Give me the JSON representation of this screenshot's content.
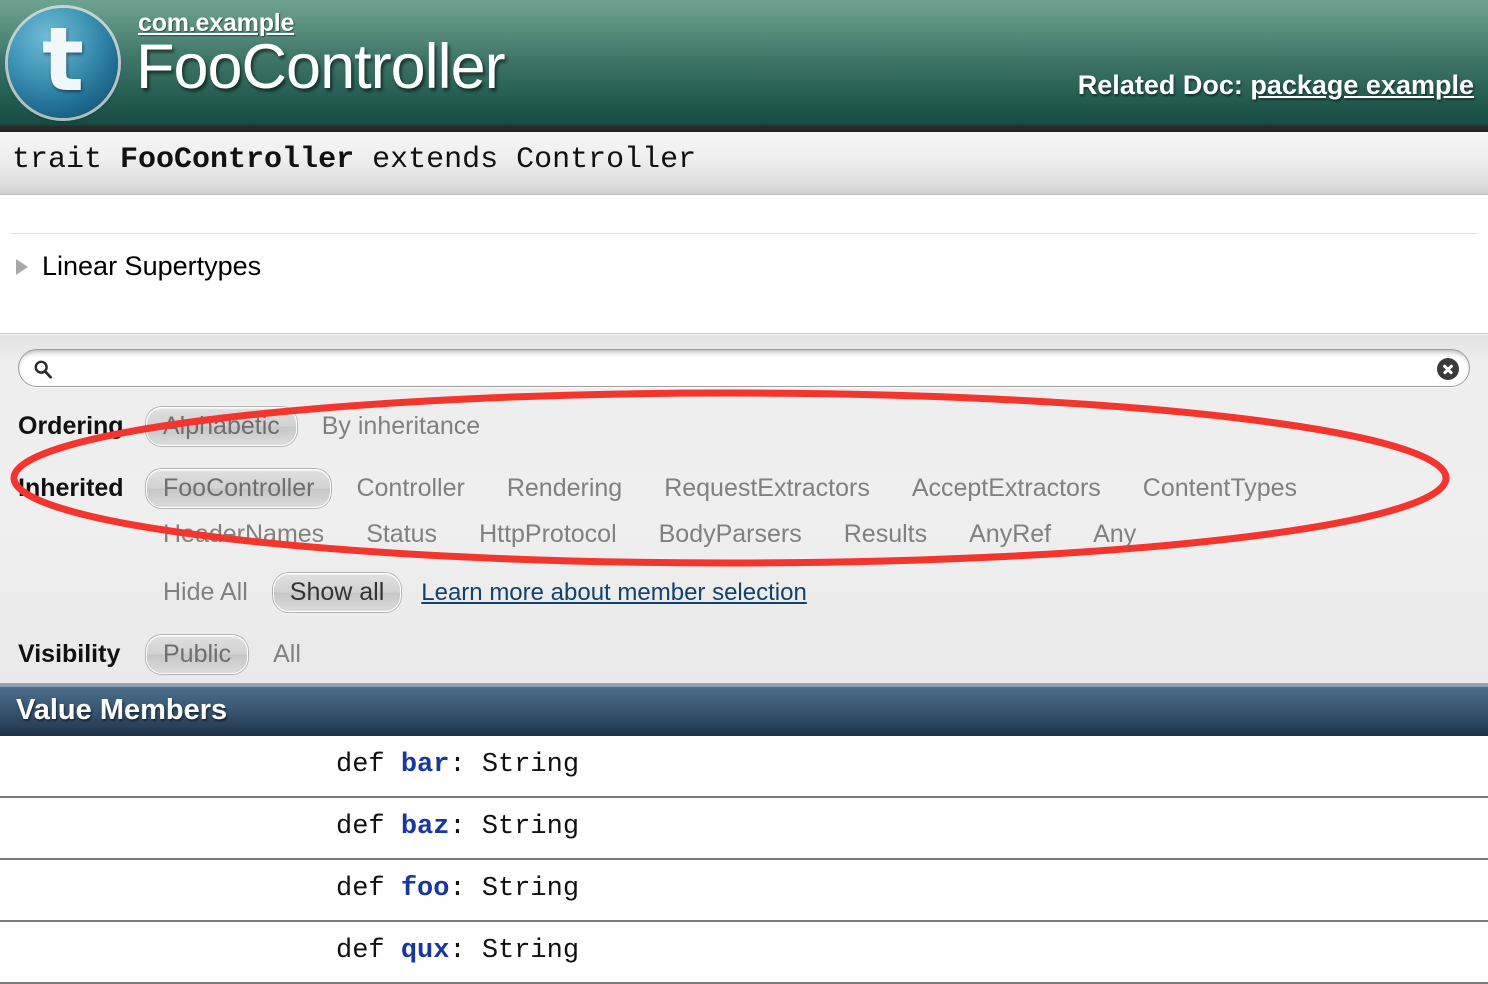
{
  "header": {
    "logo_glyph": "t",
    "package_link": "com.example",
    "entity_name": "FooController",
    "related_doc_label": "Related Doc:",
    "related_doc_link": "package example"
  },
  "signature": {
    "keyword": "trait",
    "name": "FooController",
    "extends_keyword": "extends",
    "supertype": "Controller"
  },
  "supertypes": {
    "toggle_label": "Linear Supertypes"
  },
  "search": {
    "value": "",
    "placeholder": "",
    "icon": "search-icon",
    "clear_icon": "close-circle-icon"
  },
  "filters": {
    "ordering": {
      "label": "Ordering",
      "options": [
        {
          "label": "Alphabetic",
          "selected": true
        },
        {
          "label": "By inheritance",
          "selected": false
        }
      ]
    },
    "inherited": {
      "label": "Inherited",
      "row1": [
        {
          "label": "FooController",
          "selected": true
        },
        {
          "label": "Controller",
          "selected": false
        },
        {
          "label": "Rendering",
          "selected": false
        },
        {
          "label": "RequestExtractors",
          "selected": false
        },
        {
          "label": "AcceptExtractors",
          "selected": false
        },
        {
          "label": "ContentTypes",
          "selected": false
        }
      ],
      "row2": [
        {
          "label": "HeaderNames",
          "selected": false
        },
        {
          "label": "Status",
          "selected": false
        },
        {
          "label": "HttpProtocol",
          "selected": false
        },
        {
          "label": "BodyParsers",
          "selected": false
        },
        {
          "label": "Results",
          "selected": false
        },
        {
          "label": "AnyRef",
          "selected": false
        },
        {
          "label": "Any",
          "selected": false
        }
      ]
    },
    "show_hide": {
      "hide_all": "Hide All",
      "show_all": "Show all",
      "learn_more": "Learn more about member selection"
    },
    "visibility": {
      "label": "Visibility",
      "options": [
        {
          "label": "Public",
          "selected": true
        },
        {
          "label": "All",
          "selected": false
        }
      ]
    }
  },
  "members": {
    "section_title": "Value Members",
    "items": [
      {
        "keyword": "def",
        "name": "bar",
        "separator": ": ",
        "type": "String"
      },
      {
        "keyword": "def",
        "name": "baz",
        "separator": ": ",
        "type": "String"
      },
      {
        "keyword": "def",
        "name": "foo",
        "separator": ": ",
        "type": "String"
      },
      {
        "keyword": "def",
        "name": "qux",
        "separator": ": ",
        "type": "String"
      }
    ]
  },
  "annotation": {
    "shape": "ellipse",
    "color": "#f4352e",
    "stroke_width": 7
  },
  "colors": {
    "header_gradient_top": "#6fa391",
    "header_gradient_bottom": "#174c42",
    "members_header_top": "#5b7a96",
    "members_header_bottom": "#1d3044",
    "member_name": "#17389c",
    "link": "#11416e",
    "annotation_red": "#f4352e"
  }
}
